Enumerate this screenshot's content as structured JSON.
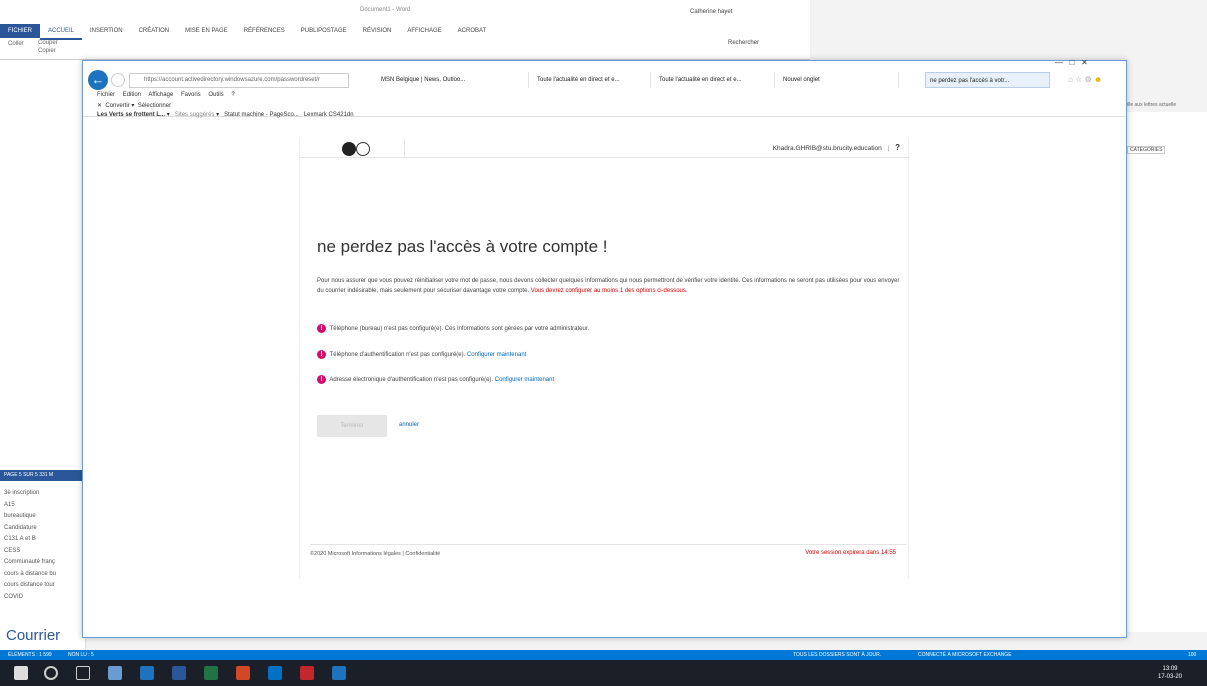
{
  "word": {
    "title": "Document1 - Word",
    "user": "Catherine hayet",
    "tabs": [
      "FICHIER",
      "ACCUEIL",
      "INSERTION",
      "CRÉATION",
      "MISE EN PAGE",
      "RÉFÉRENCES",
      "PUBLIPOSTAGE",
      "RÉVISION",
      "AFFICHAGE",
      "ACROBAT"
    ],
    "clipboard": [
      "Couper",
      "Copier",
      "Reproduire"
    ],
    "paste": "Coller",
    "clipboard_group": "Presse-pap",
    "search": "Rechercher"
  },
  "outlook": {
    "page_count": "PAGE 5 SUR 5",
    "word_count": "331 M",
    "folders": [
      "3è inscription",
      "A15",
      "bureautique",
      "Candidature",
      "C131 A et B",
      "CESS",
      "Communauté franç",
      "cours à distance bu",
      "cours distance tour",
      "COVID"
    ],
    "courrier": "Courrier",
    "categories": "CATÉGORIES",
    "filter": "ille aux lettres actuelle",
    "elements": "ÉLÉMENTS : 1 599",
    "unread": "NON LU : 5",
    "sync_status": "TOUS LES DOSSIERS SONT À JOUR.",
    "connection": "CONNECTÉ À MICROSOFT EXCHANGE",
    "zoom": "100"
  },
  "ie": {
    "url": "https://account.activedirectory.windowsazure.com/passwordreset/r",
    "tabs": [
      "MSN Belgique | News, Outloo...",
      "Toute l'actualité en direct et e...",
      "Toute l'actualité en direct et e...",
      "Nouvel onglet",
      "ne perdez pas l'accès à votr..."
    ],
    "menu": [
      "Fichier",
      "Edition",
      "Affichage",
      "Favoris",
      "Outils",
      "?"
    ],
    "convert": "Convertir",
    "select": "Sélectionner",
    "favorites": [
      "Les Verts se frottent L...",
      "Sites suggérés",
      "Statut machine - PageSco...",
      "Lexmark CS421dn"
    ]
  },
  "page": {
    "account": "Khadra.GHRIB@stu.brucity.education",
    "help": "?",
    "title": "ne perdez pas l'accès à votre compte !",
    "intro": "Pour nous assurer que vous pouvez réinitialiser votre mot de passe, nous devons collecter quelques informations qui nous permettront de vérifier votre identité. Ces informations ne seront pas utilisées pour vous envoyer du courrier indésirable, mais seulement pour sécuriser davantage votre compte.",
    "intro_red": "Vous devrez configurer au moins 1 des options ci-dessous.",
    "methods": [
      {
        "text": "Téléphone (bureau) n'est pas configuré(e). Ces informations sont gérées par votre administrateur.",
        "link": ""
      },
      {
        "text": "Téléphone d'authentification n'est pas configuré(e).",
        "link": "Configurer maintenant"
      },
      {
        "text": "Adresse électronique d'authentification n'est pas configuré(e).",
        "link": "Configurer maintenant"
      }
    ],
    "finish": "Terminer",
    "cancel": "annuler",
    "footer": "©2020 Microsoft   Informations légales  |  Confidentialité",
    "session": "Votre session expirera dans 14:55"
  },
  "taskbar": {
    "time": "13:09",
    "date": "17-03-20"
  }
}
